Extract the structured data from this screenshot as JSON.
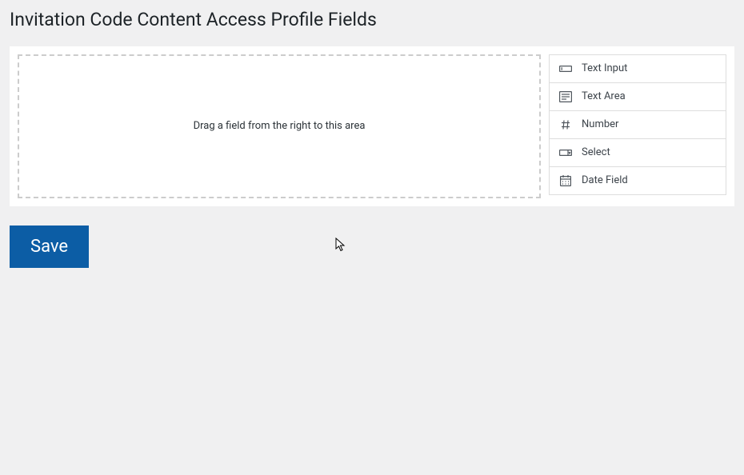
{
  "page_title": "Invitation Code Content Access Profile Fields",
  "drop_area": {
    "placeholder": "Drag a field from the right to this area"
  },
  "field_palette": [
    {
      "icon": "text-input-icon",
      "label": "Text Input"
    },
    {
      "icon": "text-area-icon",
      "label": "Text Area"
    },
    {
      "icon": "number-icon",
      "label": "Number"
    },
    {
      "icon": "select-icon",
      "label": "Select"
    },
    {
      "icon": "date-icon",
      "label": "Date Field"
    }
  ],
  "save_button_label": "Save"
}
